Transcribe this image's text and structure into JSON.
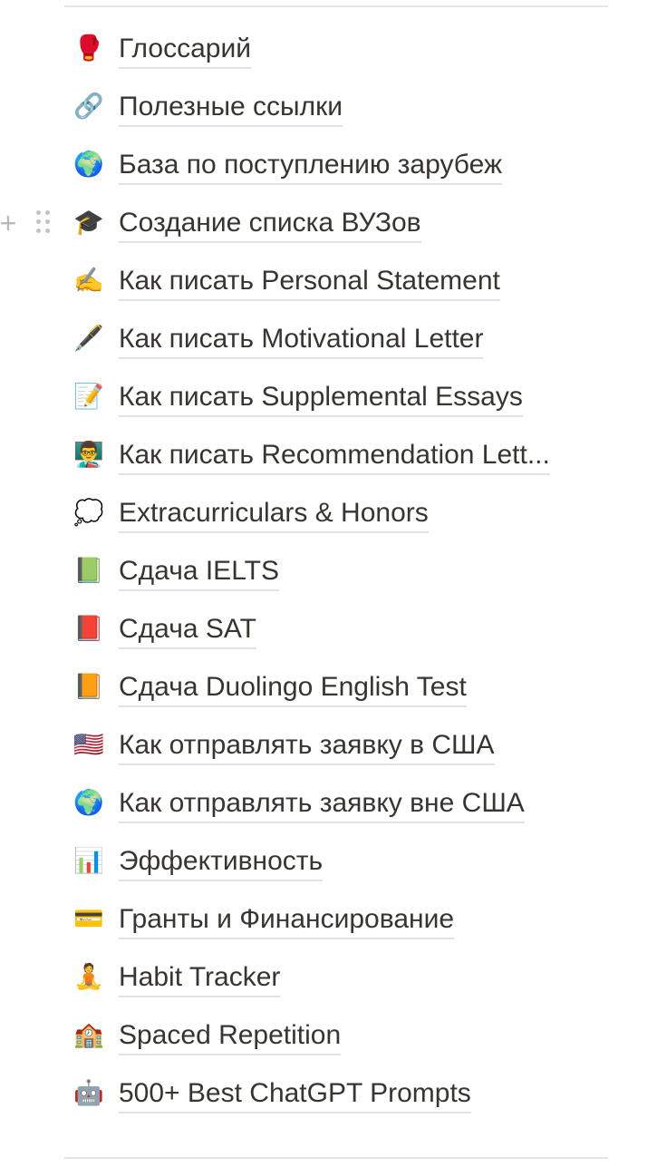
{
  "pages": [
    {
      "icon": "🥊",
      "icon_name": "boxing-glove-icon",
      "title": "Глоссарий"
    },
    {
      "icon": "🔗",
      "icon_name": "link-icon",
      "title": "Полезные ссылки"
    },
    {
      "icon": "🌍",
      "icon_name": "globe-icon",
      "title": "База по поступлению зарубеж"
    },
    {
      "icon": "🎓",
      "icon_name": "graduation-cap-icon",
      "title": "Создание списка ВУЗов"
    },
    {
      "icon": "✍️",
      "icon_name": "writing-hand-icon",
      "title": "Как писать Personal Statement"
    },
    {
      "icon": "🖋️",
      "icon_name": "fountain-pen-icon",
      "title": "Как писать Motivational Letter"
    },
    {
      "icon": "📝",
      "icon_name": "memo-icon",
      "title": "Как писать Supplemental Essays"
    },
    {
      "icon": "👨‍🏫",
      "icon_name": "teacher-icon",
      "title": "Как писать Recommendation Lett..."
    },
    {
      "icon": "💭",
      "icon_name": "thought-bubble-icon",
      "title": "Extracurriculars & Honors"
    },
    {
      "icon": "📗",
      "icon_name": "green-book-icon",
      "title": "Сдача IELTS"
    },
    {
      "icon": "📕",
      "icon_name": "red-book-icon",
      "title": "Сдача SAT"
    },
    {
      "icon": "📙",
      "icon_name": "orange-book-icon",
      "title": "Сдача Duolingo English Test"
    },
    {
      "icon": "🇺🇸",
      "icon_name": "us-flag-icon",
      "title": "Как отправлять заявку в США"
    },
    {
      "icon": "🌍",
      "icon_name": "globe-icon",
      "title": "Как отправлять заявку вне США"
    },
    {
      "icon": "📊",
      "icon_name": "bar-chart-icon",
      "title": "Эффективность"
    },
    {
      "icon": "💳",
      "icon_name": "credit-card-icon",
      "title": "Гранты и Финансирование"
    },
    {
      "icon": "🧘",
      "icon_name": "meditation-icon",
      "title": "Habit Tracker"
    },
    {
      "icon": "🏫",
      "icon_name": "school-icon",
      "title": "Spaced Repetition"
    },
    {
      "icon": "🤖",
      "icon_name": "robot-icon",
      "title": "500+ Best ChatGPT Prompts"
    }
  ],
  "hovered_row_index": 3,
  "colors": {
    "text": "#37352f",
    "underline": "#e3e2e0",
    "divider": "#e6e6e4",
    "handle": "#c3c2be"
  }
}
